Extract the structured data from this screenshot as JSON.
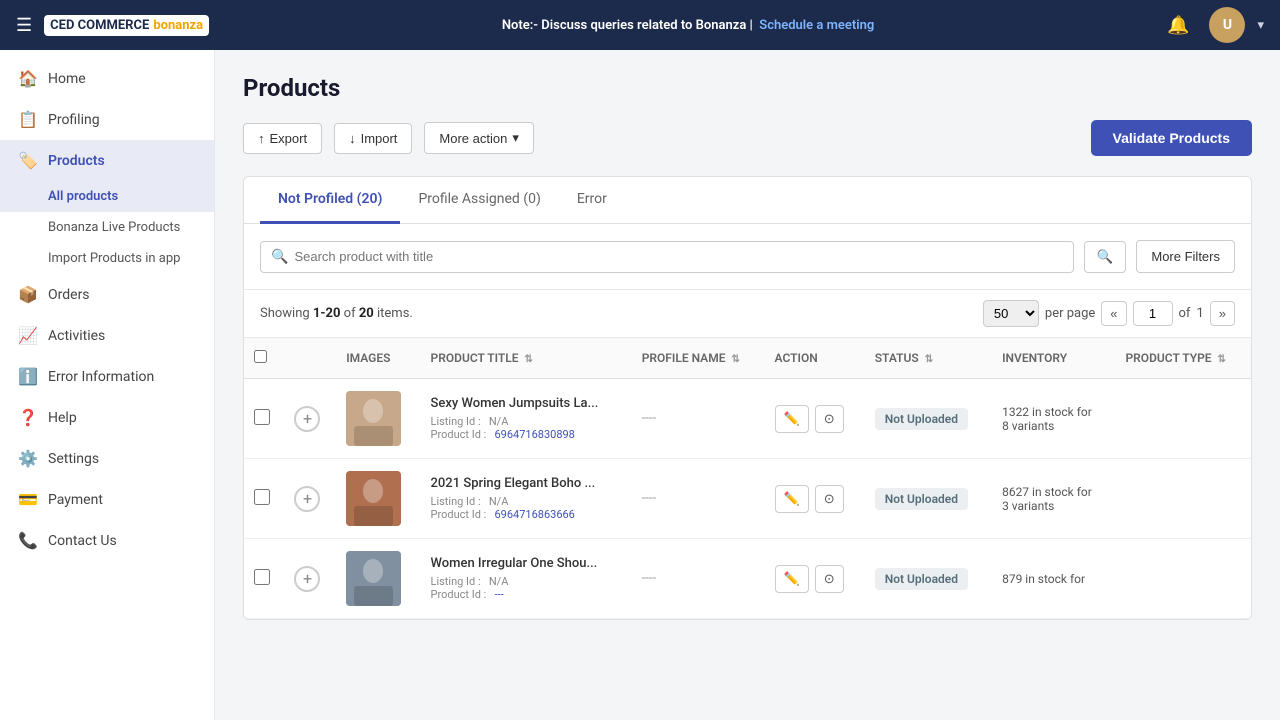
{
  "topnav": {
    "note_prefix": "Note:- Discuss queries related to Bonanza |",
    "note_link": "Schedule a meeting",
    "logo_text": "CED COMMERCE",
    "logo_bonanza": "bonanza",
    "avatar_initials": "U"
  },
  "sidebar": {
    "items": [
      {
        "id": "home",
        "label": "Home",
        "icon": "🏠",
        "active": false
      },
      {
        "id": "profiling",
        "label": "Profiling",
        "icon": "📋",
        "active": false
      },
      {
        "id": "products",
        "label": "Products",
        "icon": "🏷️",
        "active": true
      },
      {
        "id": "orders",
        "label": "Orders",
        "icon": "📦",
        "active": false
      },
      {
        "id": "activities",
        "label": "Activities",
        "icon": "📈",
        "active": false
      },
      {
        "id": "error-information",
        "label": "Error Information",
        "icon": "ℹ️",
        "active": false
      },
      {
        "id": "help",
        "label": "Help",
        "icon": "❓",
        "active": false
      },
      {
        "id": "settings",
        "label": "Settings",
        "icon": "⚙️",
        "active": false
      },
      {
        "id": "payment",
        "label": "Payment",
        "icon": "💳",
        "active": false
      },
      {
        "id": "contact-us",
        "label": "Contact Us",
        "icon": "📞",
        "active": false
      }
    ],
    "subitems": [
      {
        "id": "all-products",
        "label": "All products",
        "active": true
      },
      {
        "id": "bonanza-live-products",
        "label": "Bonanza Live Products",
        "active": false
      },
      {
        "id": "import-products-app",
        "label": "Import Products in app",
        "active": false
      }
    ]
  },
  "page": {
    "title": "Products",
    "toolbar": {
      "export_label": "Export",
      "import_label": "Import",
      "more_action_label": "More action",
      "validate_btn": "Validate Products"
    },
    "tabs": [
      {
        "id": "not-profiled",
        "label": "Not Profiled (20)",
        "active": true
      },
      {
        "id": "profile-assigned",
        "label": "Profile Assigned (0)",
        "active": false
      },
      {
        "id": "error",
        "label": "Error",
        "active": false
      }
    ],
    "search": {
      "placeholder": "Search product with title"
    },
    "more_filters_label": "More Filters",
    "showing": {
      "prefix": "Showing",
      "range": "1-20",
      "of_text": "of",
      "total": "20",
      "items_text": "items."
    },
    "pagination": {
      "per_page": "50",
      "per_page_label": "per page",
      "page_num": "1",
      "total_pages": "1"
    },
    "table": {
      "columns": [
        "",
        "",
        "IMAGES",
        "PRODUCT TITLE",
        "PROFILE NAME",
        "ACTION",
        "STATUS",
        "INVENTORY",
        "PRODUCT TYPE"
      ],
      "rows": [
        {
          "id": "row1",
          "title": "Sexy Women Jumpsuits La...",
          "listing_id": "N/A",
          "product_id": "6964716830898",
          "profile_name": "----",
          "status": "Not Uploaded",
          "inventory": "1322 in stock for",
          "inventory_variants": "8 variants",
          "product_type": "",
          "img_color": "#c8a88a"
        },
        {
          "id": "row2",
          "title": "2021 Spring Elegant Boho ...",
          "listing_id": "N/A",
          "product_id": "6964716863666",
          "profile_name": "----",
          "status": "Not Uploaded",
          "inventory": "8627 in stock for",
          "inventory_variants": "3 variants",
          "product_type": "",
          "img_color": "#b07050"
        },
        {
          "id": "row3",
          "title": "Women Irregular One Shou...",
          "listing_id": "N/A",
          "product_id": "---",
          "profile_name": "----",
          "status": "Not Uploaded",
          "inventory": "879 in stock for",
          "inventory_variants": "",
          "product_type": "",
          "img_color": "#8090a0"
        }
      ]
    }
  }
}
